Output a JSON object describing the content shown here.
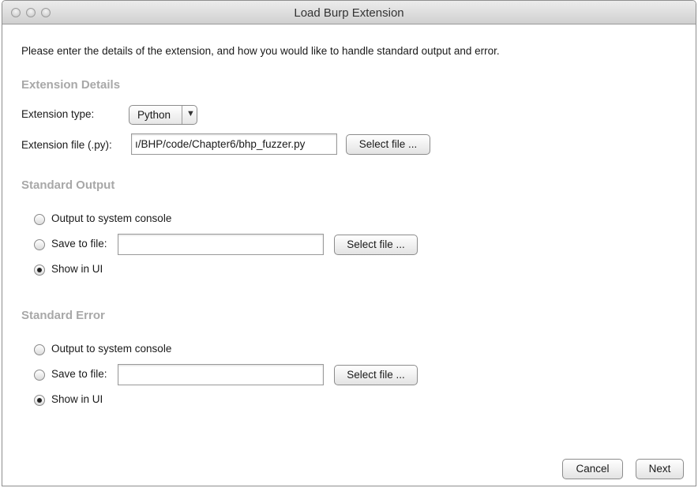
{
  "window": {
    "title": "Load Burp Extension"
  },
  "intro": "Please enter the details of the extension, and how you would like to handle standard output and error.",
  "extension_details": {
    "heading": "Extension Details",
    "type_label": "Extension type:",
    "type_value": "Python",
    "file_label": "Extension file (.py):",
    "file_value": "ı/BHP/code/Chapter6/bhp_fuzzer.py",
    "select_file": "Select file ..."
  },
  "standard_output": {
    "heading": "Standard Output",
    "options": [
      "Output to system console",
      "Save to file:",
      "Show in UI"
    ],
    "selected": "Show in UI",
    "file_value": "",
    "select_file": "Select file ..."
  },
  "standard_error": {
    "heading": "Standard Error",
    "options": [
      "Output to system console",
      "Save to file:",
      "Show in UI"
    ],
    "selected": "Show in UI",
    "file_value": "",
    "select_file": "Select file ..."
  },
  "buttons": {
    "cancel": "Cancel",
    "next": "Next"
  }
}
